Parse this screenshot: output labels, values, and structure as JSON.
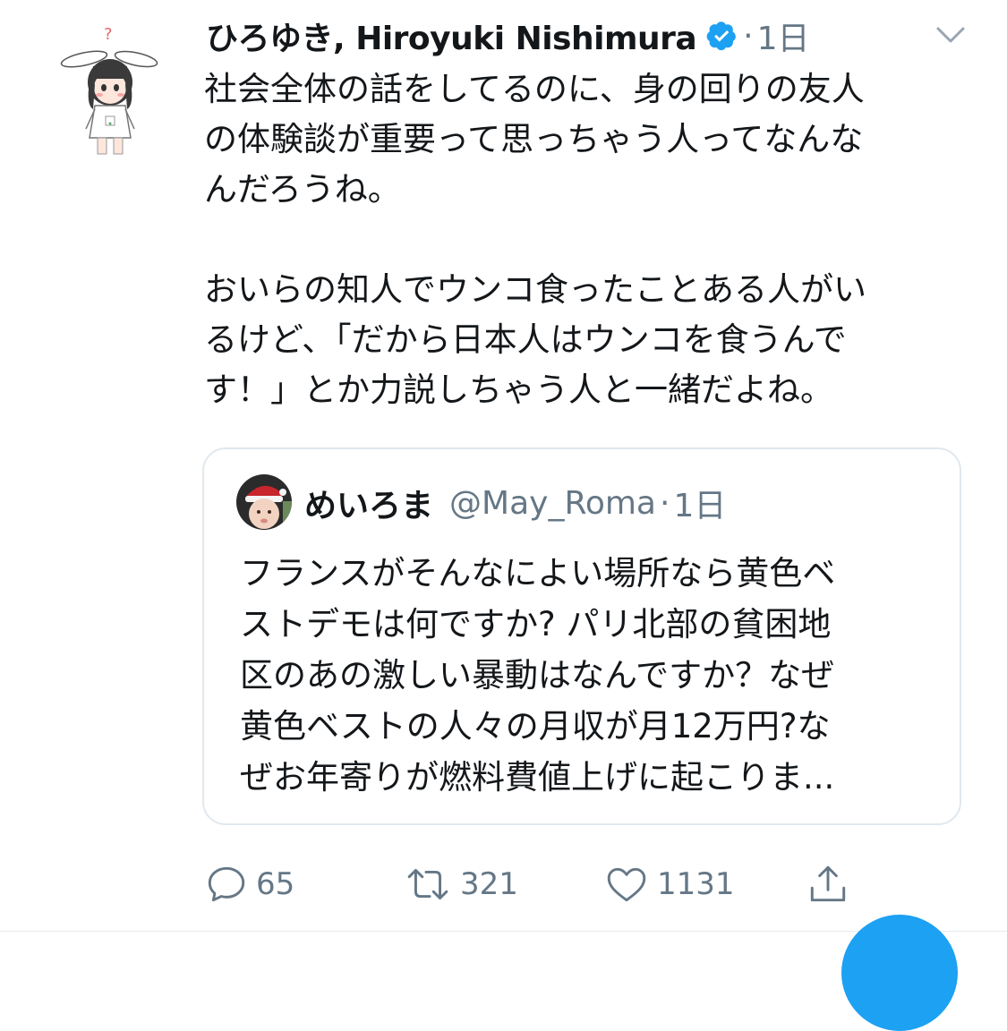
{
  "tweet": {
    "display_name": "ひろゆき, Hiroyuki Nishimura",
    "verified": true,
    "separator": "·",
    "timestamp": "1日",
    "text": "社会全体の話をしてるのに、身の回りの友人\nの体験談が重要って思っちゃう人ってなんな\nんだろうね。\n\nおいらの知人でウンコ食ったことある人がい\nるけど、「だから日本人はウンコを食うんで\nす！」とか力説しちゃう人と一緒だよね。",
    "quote": {
      "display_name": "めいろま",
      "handle": "@May_Roma",
      "separator": "·",
      "timestamp": "1日",
      "text": "フランスがそんなによい場所なら黄色ベ\nストデモは何ですか? パリ北部の貧困地\n区のあの激しい暴動はなんですか？なぜ\n黄色ベストの人々の月収が月12万円?な\nぜお年寄りが燃料費値上げに起こりま..."
    },
    "actions": {
      "reply_count": "65",
      "retweet_count": "321",
      "like_count": "1131"
    }
  },
  "colors": {
    "text_primary": "#14171a",
    "text_secondary": "#657786",
    "verified_blue": "#1da1f2",
    "border": "#e1e8ed"
  },
  "icons": {
    "menu": "chevron-down-icon",
    "verified": "verified-badge-icon",
    "reply": "reply-icon",
    "retweet": "retweet-icon",
    "like": "heart-icon",
    "share": "share-icon"
  }
}
